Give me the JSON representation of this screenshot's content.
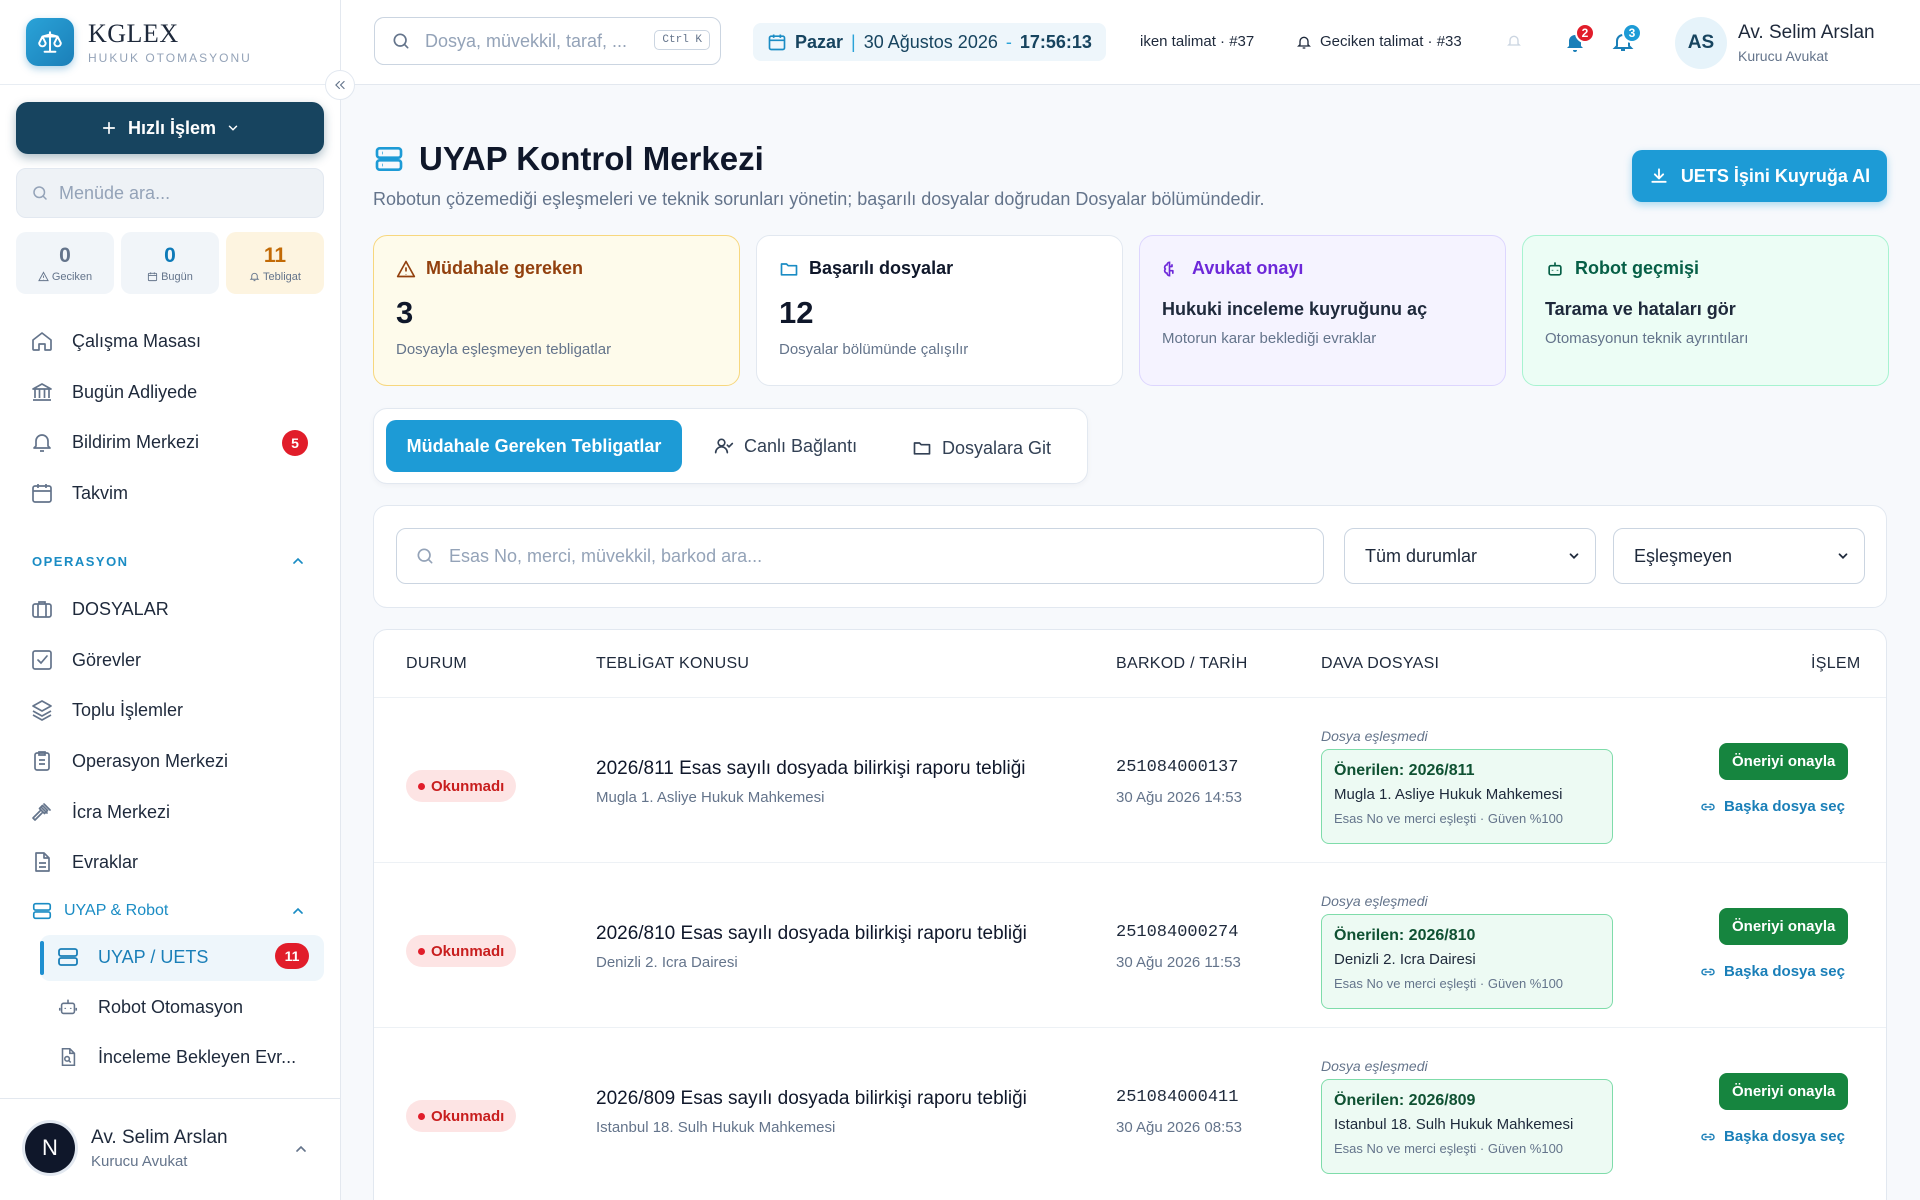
{
  "brand": {
    "name": "KGLEX",
    "subtitle": "HUKUK OTOMASYONU"
  },
  "sidebar": {
    "quick_action": "Hızlı İşlem",
    "search_placeholder": "Menüde ara...",
    "stats": [
      {
        "value": "0",
        "label": "Geciken"
      },
      {
        "value": "0",
        "label": "Bugün"
      },
      {
        "value": "11",
        "label": "Tebligat"
      }
    ],
    "main_items": [
      {
        "label": "Çalışma Masası",
        "icon": "home-icon"
      },
      {
        "label": "Bugün Adliyede",
        "icon": "courthouse-icon"
      },
      {
        "label": "Bildirim Merkezi",
        "icon": "bell-icon",
        "badge": "5"
      },
      {
        "label": "Takvim",
        "icon": "calendar-icon"
      }
    ],
    "section_operasyon": "OPERASYON",
    "operasyon_items": [
      {
        "label": "DOSYALAR",
        "icon": "briefcase-icon"
      },
      {
        "label": "Görevler",
        "icon": "checkbox-icon"
      },
      {
        "label": "Toplu İşlemler",
        "icon": "layers-icon"
      },
      {
        "label": "Operasyon Merkezi",
        "icon": "clipboard-icon"
      },
      {
        "label": "İcra Merkezi",
        "icon": "gavel-icon"
      },
      {
        "label": "Evraklar",
        "icon": "document-icon"
      }
    ],
    "section_uyap": "UYAP & Robot",
    "uyap_items": [
      {
        "label": "UYAP / UETS",
        "icon": "server-icon",
        "badge": "11",
        "active": true
      },
      {
        "label": "Robot Otomasyon",
        "icon": "robot-icon"
      },
      {
        "label": "İnceleme Bekleyen Evr...",
        "icon": "file-search-icon"
      }
    ],
    "user": {
      "initial": "N",
      "name": "Av. Selim Arslan",
      "role": "Kurucu Avukat"
    }
  },
  "topbar": {
    "search_placeholder": "Dosya, müvekkil, taraf, ...",
    "shortcut": "Ctrl K",
    "date": {
      "day": "Pazar",
      "date": "30 Ağustos 2026",
      "dash": "-",
      "time": "17:56:13"
    },
    "ticker": [
      "iken talimat · #37",
      "Geciken talimat · #33"
    ],
    "notif_badges": [
      "2",
      "3"
    ],
    "user": {
      "initials": "AS",
      "name": "Av. Selim Arslan",
      "role": "Kurucu Avukat"
    }
  },
  "page": {
    "title": "UYAP Kontrol Merkezi",
    "subtitle": "Robotun çözemediği eşleşmeleri ve teknik sorunları yönetin; başarılı dosyalar doğrudan Dosyalar bölümündedir.",
    "primary_button": "UETS İşini Kuyruğa Al"
  },
  "cards": [
    {
      "title": "Müdahale gereken",
      "value": "3",
      "sub": "Dosyayla eşleşmeyen tebligatlar",
      "accent": "#92400e"
    },
    {
      "title": "Başarılı dosyalar",
      "value": "12",
      "sub": "Dosyalar bölümünde çalışılır",
      "accent": "#0f172a"
    },
    {
      "title": "Avukat onayı",
      "headline": "Hukuki inceleme kuyruğunu aç",
      "sub": "Motorun karar beklediği evraklar",
      "accent": "#6d28d9"
    },
    {
      "title": "Robot geçmişi",
      "headline": "Tarama ve hataları gör",
      "sub": "Otomasyonun teknik ayrıntıları",
      "accent": "#065f46"
    }
  ],
  "tabs": [
    "Müdahale Gereken Tebligatlar",
    "Canlı Bağlantı",
    "Dosyalara Git"
  ],
  "filters": {
    "search_placeholder": "Esas No, merci, müvekkil, barkod ara...",
    "status_select": "Tüm durumlar",
    "match_select": "Eşleşmeyen"
  },
  "table": {
    "headers": [
      "DURUM",
      "TEBLİGAT KONUSU",
      "BARKOD / TARİH",
      "DAVA DOSYASI",
      "İŞLEM"
    ],
    "rows": [
      {
        "status": "Okunmadı",
        "subject": "2026/811 Esas sayılı dosyada bilirkişi raporu tebliği",
        "court": "Mugla 1. Asliye Hukuk Mahkemesi",
        "barcode": "251084000137",
        "date": "30 Ağu 2026 14:53",
        "match_note": "Dosya eşleşmedi",
        "suggestion": "Önerilen: 2026/811",
        "suggestion_court": "Mugla 1. Asliye Hukuk Mahkemesi",
        "suggestion_meta": "Esas No ve merci eşleşti · Güven %100",
        "approve": "Öneriyi onayla",
        "other": "Başka dosya seç"
      },
      {
        "status": "Okunmadı",
        "subject": "2026/810 Esas sayılı dosyada bilirkişi raporu tebliği",
        "court": "Denizli 2. Icra Dairesi",
        "barcode": "251084000274",
        "date": "30 Ağu 2026 11:53",
        "match_note": "Dosya eşleşmedi",
        "suggestion": "Önerilen: 2026/810",
        "suggestion_court": "Denizli 2. Icra Dairesi",
        "suggestion_meta": "Esas No ve merci eşleşti · Güven %100",
        "approve": "Öneriyi onayla",
        "other": "Başka dosya seç"
      },
      {
        "status": "Okunmadı",
        "subject": "2026/809 Esas sayılı dosyada bilirkişi raporu tebliği",
        "court": "Istanbul 18. Sulh Hukuk Mahkemesi",
        "barcode": "251084000411",
        "date": "30 Ağu 2026 08:53",
        "match_note": "Dosya eşleşmedi",
        "suggestion": "Önerilen: 2026/809",
        "suggestion_court": "Istanbul 18. Sulh Hukuk Mahkemesi",
        "suggestion_meta": "Esas No ve merci eşleşti · Güven %100",
        "approve": "Öneriyi onayla",
        "other": "Başka dosya seç"
      }
    ]
  }
}
